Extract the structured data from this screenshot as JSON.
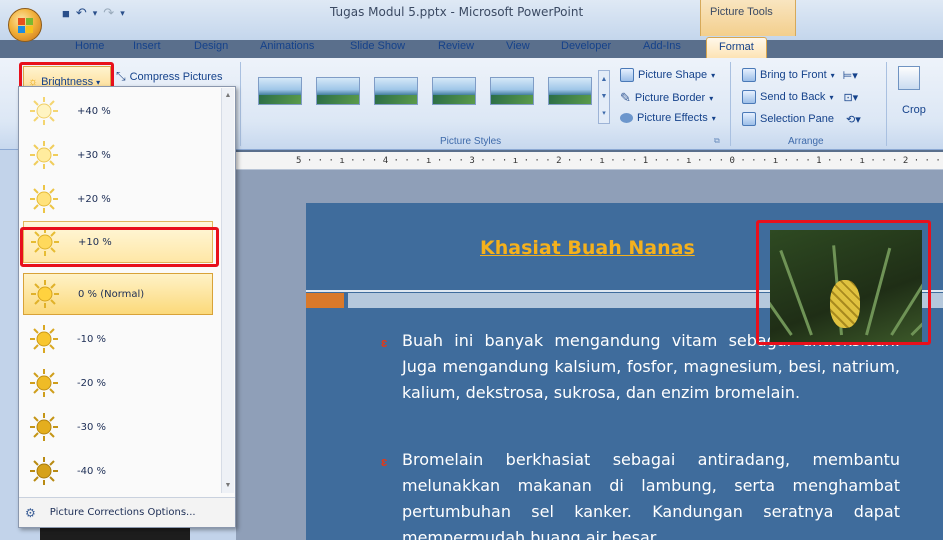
{
  "window": {
    "title": "Tugas Modul 5.pptx - Microsoft PowerPoint",
    "context_group": "Picture Tools"
  },
  "tabs": [
    {
      "label": "Home"
    },
    {
      "label": "Insert"
    },
    {
      "label": "Design"
    },
    {
      "label": "Animations"
    },
    {
      "label": "Slide Show"
    },
    {
      "label": "Review"
    },
    {
      "label": "View"
    },
    {
      "label": "Developer"
    },
    {
      "label": "Add-Ins"
    },
    {
      "label": "Format",
      "active": true
    }
  ],
  "ribbon": {
    "adjust": {
      "brightness_label": "Brightness",
      "compress_label": "Compress Pictures"
    },
    "picture_styles": {
      "group_label": "Picture Styles",
      "shape_label": "Picture Shape",
      "border_label": "Picture Border",
      "effects_label": "Picture Effects"
    },
    "arrange": {
      "group_label": "Arrange",
      "front_label": "Bring to Front",
      "back_label": "Send to Back",
      "selection_label": "Selection Pane"
    },
    "size": {
      "crop_label": "Crop"
    }
  },
  "ruler": {
    "text": "5 · · · ı · · · 4 · · · ı · · · 3 · · · ı · · · 2 · · · ı · · · 1 · · · ı · · · 0 · · · ı · · · 1 · · · ı · · · 2 · · · ı · · · 3 · · · ı · · · 4 · · ·"
  },
  "brightness_menu": {
    "items": [
      {
        "label": "+40 %",
        "state": "normal"
      },
      {
        "label": "+30 %",
        "state": "normal"
      },
      {
        "label": "+20 %",
        "state": "normal"
      },
      {
        "label": "+10 %",
        "state": "hover"
      },
      {
        "label": "0 % (Normal)",
        "state": "selected"
      },
      {
        "label": "-10 %",
        "state": "normal"
      },
      {
        "label": "-20 %",
        "state": "normal"
      },
      {
        "label": "-30 %",
        "state": "normal"
      },
      {
        "label": "-40 %",
        "state": "normal"
      }
    ],
    "footer_label": "Picture Corrections Options..."
  },
  "slide": {
    "title": "Khasiat Buah Nanas",
    "para1": "Buah ini banyak mengandung vitam sebagai antioksidan. Juga mengandung kalsium, fosfor, magnesium, besi, natrium, kalium, dekstrosa, sukrosa, dan enzim bromelain.",
    "para2": "Bromelain berkhasiat sebagai antiradang, membantu melunakkan makanan di lambung, serta menghambat pertumbuhan sel kanker. Kandungan seratnya dapat mempermudah buang air besar"
  },
  "colors": {
    "highlight_box": "#e8101c",
    "slide_bg": "#3f6c9c",
    "title": "#f5b11c"
  }
}
